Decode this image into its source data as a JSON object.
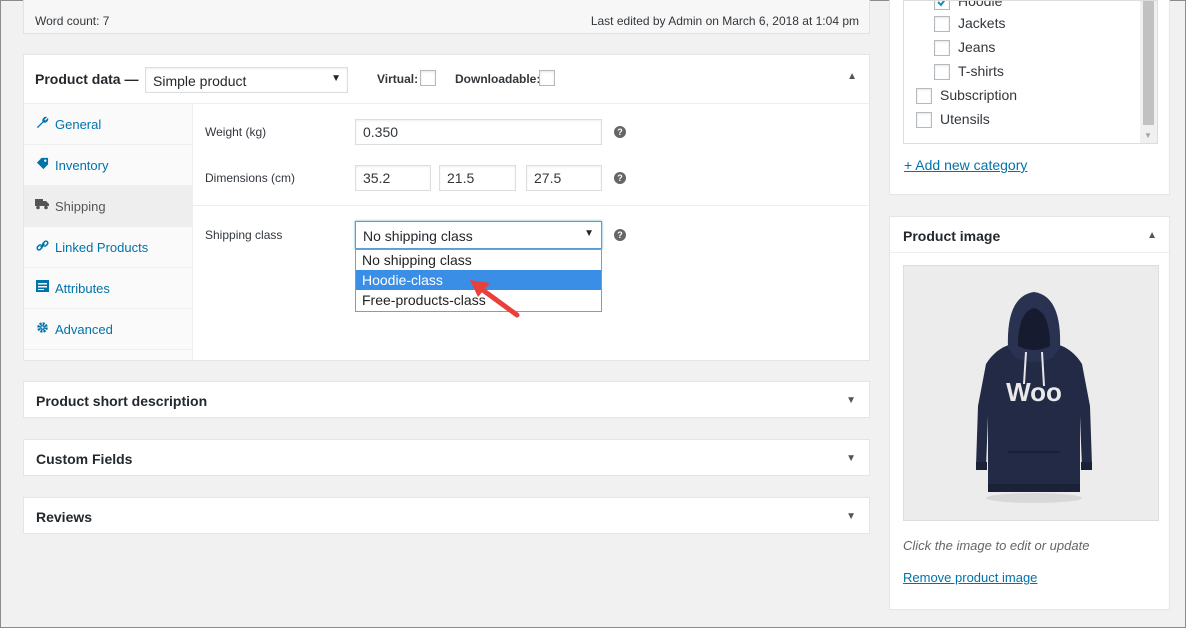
{
  "editor_status": {
    "word_count": "Word count: 7",
    "last_edited": "Last edited by Admin on March 6, 2018 at 1:04 pm"
  },
  "product_data": {
    "title": "Product data —",
    "type_value": "Simple product",
    "virtual_label": "Virtual:",
    "downloadable_label": "Downloadable:",
    "tabs": [
      {
        "label": "General",
        "icon": "wrench-icon"
      },
      {
        "label": "Inventory",
        "icon": "tag-icon"
      },
      {
        "label": "Shipping",
        "icon": "truck-icon",
        "active": true
      },
      {
        "label": "Linked Products",
        "icon": "link-icon"
      },
      {
        "label": "Attributes",
        "icon": "list-icon"
      },
      {
        "label": "Advanced",
        "icon": "gear-icon"
      }
    ],
    "weight_label": "Weight (kg)",
    "weight_value": "0.350",
    "dimensions_label": "Dimensions (cm)",
    "length_value": "35.2",
    "width_value": "21.5",
    "height_value": "27.5",
    "shipping_class_label": "Shipping class",
    "shipping_class_value": "No shipping class",
    "shipping_options": [
      "No shipping class",
      "Hoodie-class",
      "Free-products-class"
    ],
    "highlighted_option": "Hoodie-class"
  },
  "panels": {
    "short_description": "Product short description",
    "custom_fields": "Custom Fields",
    "reviews": "Reviews"
  },
  "categories": {
    "items": [
      "Hoodie",
      "Jackets",
      "Jeans",
      "T-shirts",
      "Subscription",
      "Utensils"
    ],
    "add_new": "+ Add new category"
  },
  "product_image": {
    "title": "Product image",
    "logo_text": "Woo",
    "caption": "Click the image to edit or update",
    "remove_link": "Remove product image"
  },
  "colors": {
    "link": "#0073aa",
    "highlight": "#3a8ee6",
    "arrow": "#e8413c",
    "hoodie": "#232a46"
  }
}
